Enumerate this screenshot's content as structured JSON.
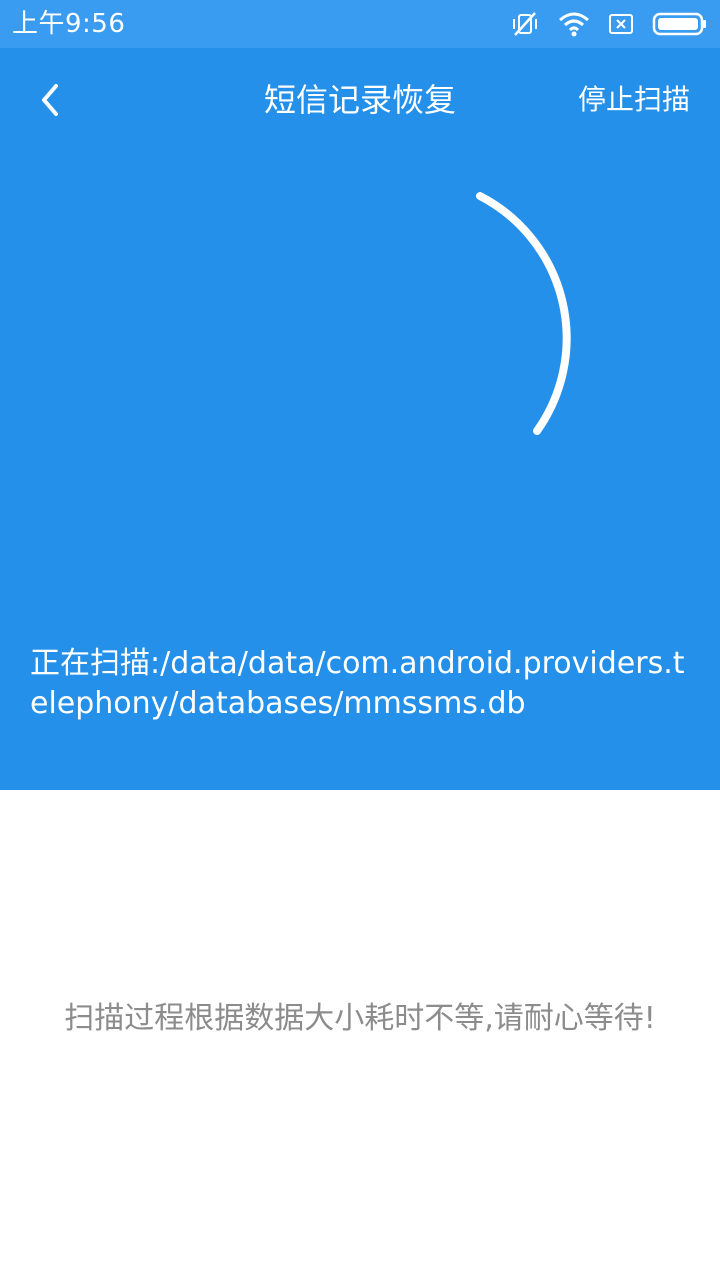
{
  "status_bar": {
    "time": "上午9:56",
    "icons": [
      "vibrate-off-icon",
      "wifi-icon",
      "sim-card-icon",
      "battery-icon"
    ]
  },
  "header": {
    "title": "短信记录恢复",
    "stop_scan_label": "停止扫描",
    "back_icon": "chevron-left-icon"
  },
  "scan": {
    "path_text": "正在扫描:/data/data/com.android.providers.telephony/databases/mmssms.db"
  },
  "hint": {
    "text": "扫描过程根据数据大小耗时不等,请耐心等待!"
  },
  "colors": {
    "status_bar": "#3a9cf0",
    "primary_blue": "#2590e9",
    "hint_gray": "#8c8c8c",
    "background": "#ffffff"
  }
}
